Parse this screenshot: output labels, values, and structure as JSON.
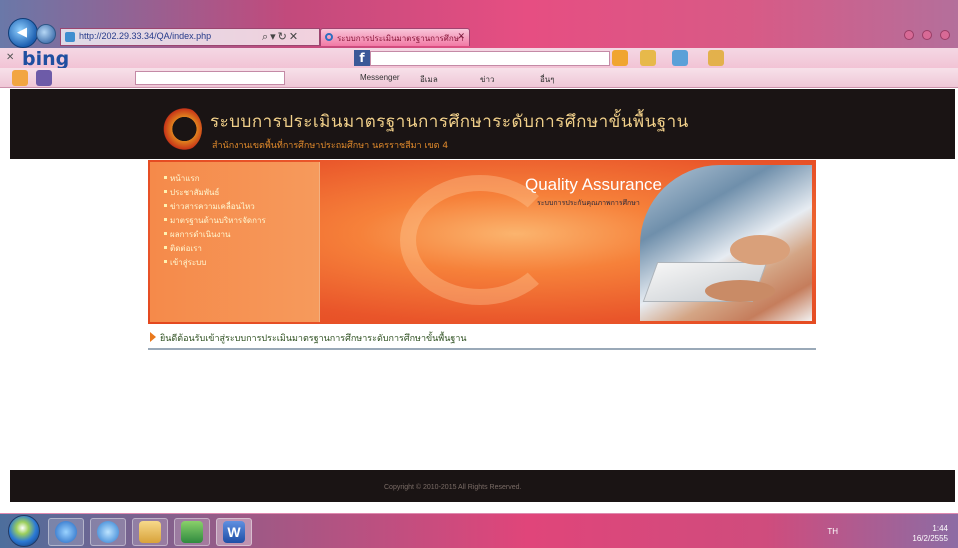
{
  "browser": {
    "address": "http://202.29.33.34/QA/index.php",
    "address_suffix": "",
    "tab_title": "ระบบการประเมินมาตรฐานการศึกษา",
    "topright": ""
  },
  "bing_toolbar": {
    "logo": "bing",
    "search_placeholder": ""
  },
  "toolbar2": {
    "messenger_label": "Messenger",
    "mail_label": "อีเมล",
    "news_label": "ข่าว",
    "more_label": "อื่นๆ"
  },
  "site": {
    "title": "ระบบการประเมินมาตรฐานการศึกษาระดับการศึกษาขั้นพื้นฐาน",
    "subtitle": "สำนักงานเขตพื้นที่การศึกษาประถมศึกษา นครราชสีมา เขต 4",
    "menu": [
      "หน้าแรก",
      "ประชาสัมพันธ์",
      "ข่าวสารความเคลื่อนไหว",
      "มาตรฐานด้านบริหารจัดการ",
      "ผลการดำเนินงาน",
      "ติดต่อเรา",
      "เข้าสู่ระบบ"
    ],
    "banner_title": "Quality Assurance",
    "banner_subtitle": "ระบบการประกันคุณภาพการศึกษา",
    "news_heading": "ยินดีต้อนรับเข้าสู่ระบบการประเมินมาตรฐานการศึกษาระดับการศึกษาขั้นพื้นฐาน",
    "footer": "Copyright © 2010-2015 All Rights Reserved."
  },
  "taskbar": {
    "language": "TH",
    "time": "1:44",
    "date": "16/2/2555"
  },
  "colors": {
    "header_bg": "#1a1414",
    "banner_orange": "#f6813a",
    "title_gold": "#f1d08a"
  }
}
